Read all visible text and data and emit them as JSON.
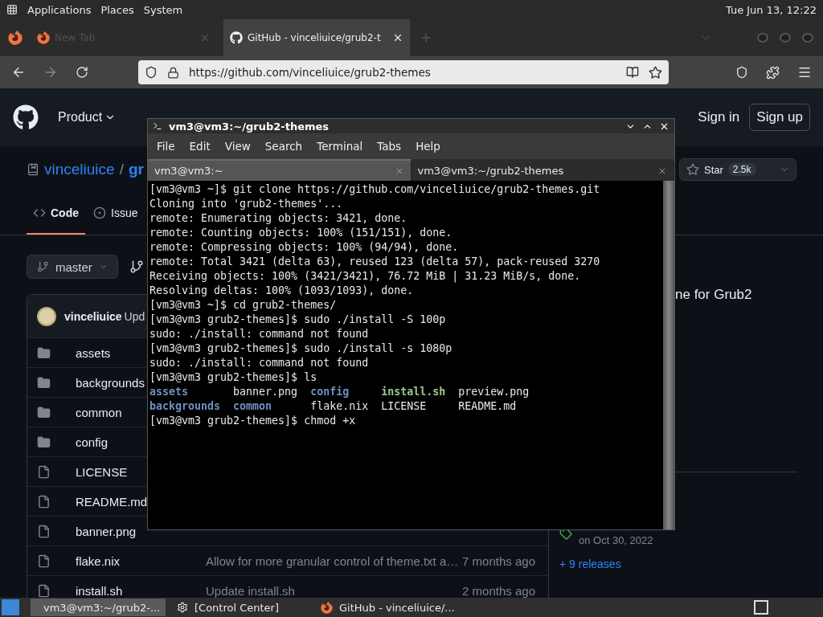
{
  "top_panel": {
    "menus": [
      "Applications",
      "Places",
      "System"
    ],
    "clock": "Tue Jun 13, 12:22"
  },
  "browser": {
    "tabs": [
      {
        "label": "New Tab",
        "selected": false
      },
      {
        "label": "GitHub - vinceliuice/grub2-t",
        "selected": true
      }
    ],
    "url": "https://github.com/vinceliuice/grub2-themes"
  },
  "github": {
    "nav": [
      "Product"
    ],
    "sign_in": "Sign in",
    "sign_up": "Sign up",
    "owner": "vinceliuice",
    "separator": "/",
    "repo": "gr",
    "star_label": "Star",
    "star_count": "2.5k",
    "tabs": [
      {
        "label": "Code",
        "selected": true
      },
      {
        "label": "Issue",
        "selected": false
      }
    ],
    "branch": "master",
    "commit": {
      "author": "vinceliuice",
      "message": "Upd"
    },
    "files": [
      {
        "name": "assets",
        "kind": "folder"
      },
      {
        "name": "backgrounds",
        "kind": "folder"
      },
      {
        "name": "common",
        "kind": "folder"
      },
      {
        "name": "config",
        "kind": "folder"
      },
      {
        "name": "LICENSE",
        "kind": "file"
      },
      {
        "name": "README.md",
        "kind": "file"
      },
      {
        "name": "banner.png",
        "kind": "file"
      },
      {
        "name": "flake.nix",
        "kind": "file",
        "message": "Allow for more granular control of theme.txt a…",
        "time": "7 months ago"
      },
      {
        "name": "install.sh",
        "kind": "file",
        "message": "Update install.sh",
        "time": "2 months ago"
      }
    ],
    "about": "ne for Grub2",
    "release_date": "on Oct 30, 2022",
    "releases_link": "+ 9 releases"
  },
  "terminal": {
    "title": "vm3@vm3:~/grub2-themes",
    "menu": [
      "File",
      "Edit",
      "View",
      "Search",
      "Terminal",
      "Tabs",
      "Help"
    ],
    "tabs": [
      {
        "label": "vm3@vm3:~",
        "selected": false
      },
      {
        "label": "vm3@vm3:~/grub2-themes",
        "selected": true
      }
    ],
    "lines": [
      {
        "text": "[vm3@vm3 ~]$ git clone https://github.com/vinceliuice/grub2-themes.git"
      },
      {
        "text": "Cloning into 'grub2-themes'..."
      },
      {
        "text": "remote: Enumerating objects: 3421, done."
      },
      {
        "text": "remote: Counting objects: 100% (151/151), done."
      },
      {
        "text": "remote: Compressing objects: 100% (94/94), done."
      },
      {
        "text": "remote: Total 3421 (delta 63), reused 123 (delta 57), pack-reused 3270"
      },
      {
        "text": "Receiving objects: 100% (3421/3421), 76.72 MiB | 31.23 MiB/s, done."
      },
      {
        "text": "Resolving deltas: 100% (1093/1093), done."
      },
      {
        "text": "[vm3@vm3 ~]$ cd grub2-themes/"
      },
      {
        "text": "[vm3@vm3 grub2-themes]$ sudo ./install -S 100p"
      },
      {
        "text": "sudo: ./install: command not found"
      },
      {
        "text": "[vm3@vm3 grub2-themes]$ sudo ./install -s 1080p"
      },
      {
        "text": "sudo: ./install: command not found"
      },
      {
        "text": "[vm3@vm3 grub2-themes]$ ls"
      },
      {
        "entries": [
          {
            "text": "assets",
            "kind": "dir"
          },
          {
            "text": "banner.png",
            "kind": "file"
          },
          {
            "text": "config",
            "kind": "dir"
          },
          {
            "text": "install.sh",
            "kind": "exec"
          },
          {
            "text": "preview.png",
            "kind": "file"
          }
        ]
      },
      {
        "entries": [
          {
            "text": "backgrounds",
            "kind": "dir"
          },
          {
            "text": "common",
            "kind": "dir"
          },
          {
            "text": "flake.nix",
            "kind": "file"
          },
          {
            "text": "LICENSE",
            "kind": "file"
          },
          {
            "text": "README.md",
            "kind": "file"
          }
        ]
      },
      {
        "text": "[vm3@vm3 grub2-themes]$ chmod +x"
      }
    ]
  },
  "taskbar": {
    "tasks": [
      {
        "label": "vm3@vm3:~/grub2-...",
        "kind": "terminal",
        "selected": true
      },
      {
        "label": "[Control Center]",
        "kind": "settings",
        "selected": false
      },
      {
        "label": "GitHub - vinceliuice/...",
        "kind": "browser",
        "selected": false
      }
    ]
  }
}
